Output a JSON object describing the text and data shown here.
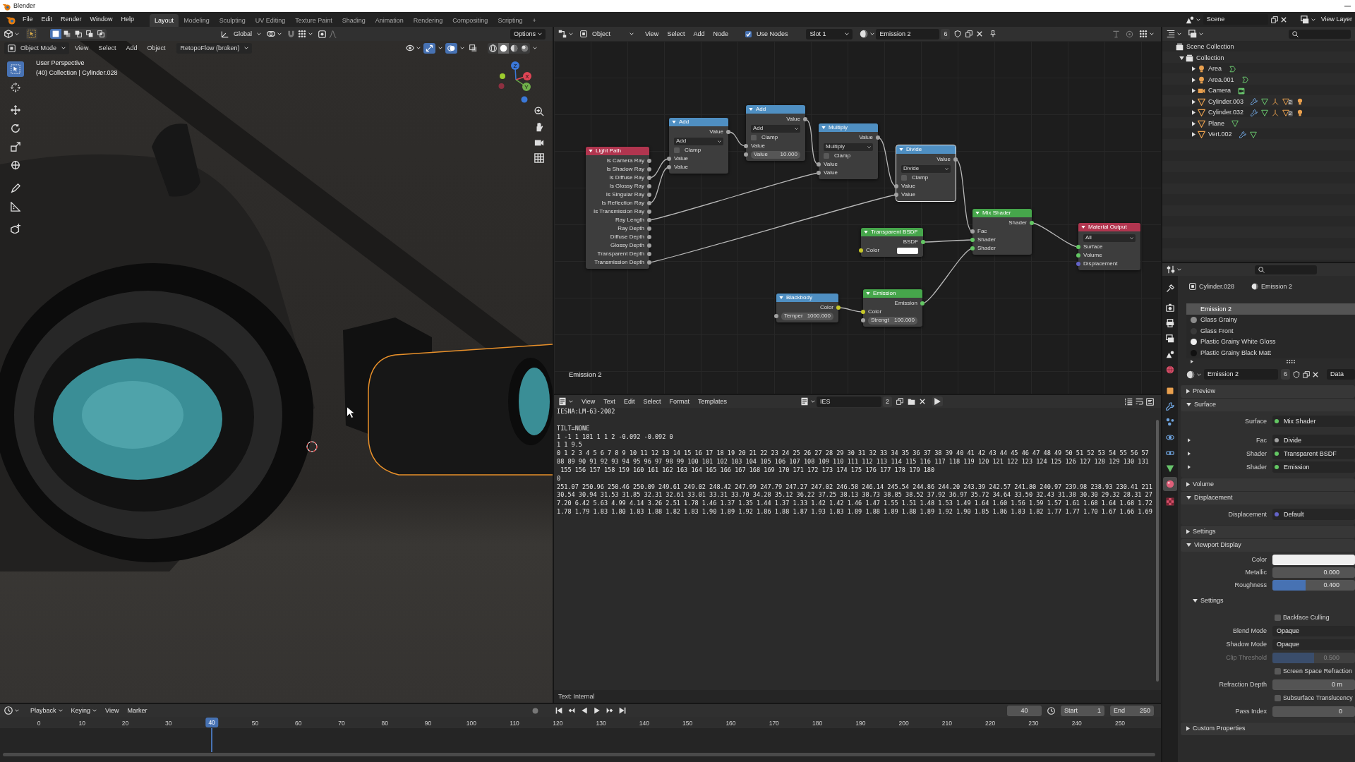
{
  "window": {
    "title": "Blender"
  },
  "top_bar": {
    "menus": [
      "File",
      "Edit",
      "Render",
      "Window",
      "Help"
    ],
    "workspaces": [
      {
        "label": "Layout",
        "selected": true
      },
      {
        "label": "Modeling",
        "selected": false
      },
      {
        "label": "Sculpting",
        "selected": false
      },
      {
        "label": "UV Editing",
        "selected": false
      },
      {
        "label": "Texture Paint",
        "selected": false
      },
      {
        "label": "Shading",
        "selected": false
      },
      {
        "label": "Animation",
        "selected": false
      },
      {
        "label": "Rendering",
        "selected": false
      },
      {
        "label": "Compositing",
        "selected": false
      },
      {
        "label": "Scripting",
        "selected": false
      }
    ],
    "add_tab": "+",
    "scene": "Scene",
    "view_layer": "View Layer"
  },
  "viewport": {
    "select_modes": [
      {
        "kind": "set",
        "selected": true
      },
      {
        "kind": "extend",
        "selected": false
      },
      {
        "kind": "subtract",
        "selected": false
      },
      {
        "kind": "invert",
        "selected": false
      },
      {
        "kind": "intersect",
        "selected": false
      }
    ],
    "orientation": "Global",
    "options": "Options",
    "mode": "Object Mode",
    "menus": [
      "View",
      "Select",
      "Add",
      "Object"
    ],
    "addon_menu": "RetopoFlow (broken)",
    "show_gizmos": true,
    "show_overlays": true,
    "xray": false,
    "shading": [
      {
        "kind": "wireframe",
        "selected": false
      },
      {
        "kind": "solid",
        "selected": true
      },
      {
        "kind": "material",
        "selected": false
      },
      {
        "kind": "rendered",
        "selected": false
      }
    ],
    "tools": [
      {
        "kind": "select_box",
        "selected": true
      },
      {
        "kind": "cursor",
        "selected": false
      },
      {
        "kind": "move",
        "selected": false
      },
      {
        "kind": "rotate",
        "selected": false
      },
      {
        "kind": "scale",
        "selected": false
      },
      {
        "kind": "transform",
        "selected": false
      },
      {
        "kind": "annotate",
        "selected": false
      },
      {
        "kind": "measure",
        "selected": false
      },
      {
        "kind": "add_cube",
        "selected": false
      }
    ],
    "view_name": "User Perspective",
    "object_info": "(40) Collection | Cylinder.028",
    "axes": [
      "X",
      "Y",
      "Z"
    ]
  },
  "node_editor": {
    "object_type": "Object",
    "menus": [
      "View",
      "Select",
      "Add",
      "Node"
    ],
    "use_nodes": {
      "label": "Use Nodes",
      "checked": true
    },
    "slot": "Slot 1",
    "material": "Emission 2",
    "users": "6",
    "frame_label": "Emission 2",
    "nodes": [
      {
        "title": "Light Path",
        "kind": "input",
        "selected": false,
        "outputs": [
          {
            "label": "Is Camera Ray",
            "kind": "value"
          },
          {
            "label": "Is Shadow Ray",
            "kind": "value"
          },
          {
            "label": "Is Diffuse Ray",
            "kind": "value"
          },
          {
            "label": "Is Glossy Ray",
            "kind": "value"
          },
          {
            "label": "Is Singular Ray",
            "kind": "value"
          },
          {
            "label": "Is Reflection Ray",
            "kind": "value"
          },
          {
            "label": "Is Transmission Ray",
            "kind": "value"
          },
          {
            "label": "Ray Length",
            "kind": "value"
          },
          {
            "label": "Ray Depth",
            "kind": "value"
          },
          {
            "label": "Diffuse Depth",
            "kind": "value"
          },
          {
            "label": "Glossy Depth",
            "kind": "value"
          },
          {
            "label": "Transparent Depth",
            "kind": "value"
          },
          {
            "label": "Transmission Depth",
            "kind": "value"
          }
        ]
      },
      {
        "title": "Add",
        "kind": "converter",
        "selected": false,
        "outputs": [
          {
            "label": "Value",
            "kind": "value"
          }
        ],
        "controls": [
          {
            "kind": "dropdown",
            "value": "Add"
          },
          {
            "kind": "checkbox",
            "label": "Clamp",
            "checked": false
          }
        ],
        "inputs": [
          {
            "label": "Value",
            "kind": "value"
          },
          {
            "label": "Value",
            "kind": "value"
          }
        ]
      },
      {
        "title": "Add",
        "kind": "converter",
        "selected": false,
        "outputs": [
          {
            "label": "Value",
            "kind": "value"
          }
        ],
        "controls": [
          {
            "kind": "dropdown",
            "value": "Add"
          },
          {
            "kind": "checkbox",
            "label": "Clamp",
            "checked": false
          }
        ],
        "inputs": [
          {
            "label": "Value",
            "kind": "value"
          },
          {
            "label": "Value",
            "value": "10.000",
            "kind": "value"
          }
        ]
      },
      {
        "title": "Multiply",
        "kind": "converter",
        "selected": false,
        "outputs": [
          {
            "label": "Value",
            "kind": "value"
          }
        ],
        "controls": [
          {
            "kind": "dropdown",
            "value": "Multiply"
          },
          {
            "kind": "checkbox",
            "label": "Clamp",
            "checked": false
          }
        ],
        "inputs": [
          {
            "label": "Value",
            "kind": "value"
          },
          {
            "label": "Value",
            "kind": "value"
          }
        ]
      },
      {
        "title": "Divide",
        "kind": "converter",
        "selected": true,
        "outputs": [
          {
            "label": "Value",
            "kind": "value"
          }
        ],
        "controls": [
          {
            "kind": "dropdown",
            "value": "Divide"
          },
          {
            "kind": "checkbox",
            "label": "Clamp",
            "checked": false
          }
        ],
        "inputs": [
          {
            "label": "Value",
            "kind": "value"
          },
          {
            "label": "Value",
            "kind": "value"
          }
        ]
      },
      {
        "title": "Transparent BSDF",
        "kind": "shader",
        "selected": false,
        "outputs": [
          {
            "label": "BSDF",
            "kind": "shader"
          }
        ],
        "inputs": [
          {
            "label": "Color",
            "kind": "color",
            "color": "#ffffff"
          }
        ]
      },
      {
        "title": "Mix Shader",
        "kind": "shader",
        "selected": false,
        "outputs": [
          {
            "label": "Shader",
            "kind": "shader"
          }
        ],
        "inputs": [
          {
            "label": "Fac",
            "kind": "value"
          },
          {
            "label": "Shader",
            "kind": "shader"
          },
          {
            "label": "Shader",
            "kind": "shader"
          }
        ]
      },
      {
        "title": "Material Output",
        "kind": "output",
        "selected": false,
        "controls": [
          {
            "kind": "dropdown",
            "value": "All"
          }
        ],
        "inputs": [
          {
            "label": "Surface",
            "kind": "shader"
          },
          {
            "label": "Volume",
            "kind": "shader"
          },
          {
            "label": "Displacement",
            "kind": "vector"
          }
        ]
      },
      {
        "title": "Blackbody",
        "kind": "converter",
        "selected": false,
        "outputs": [
          {
            "label": "Color",
            "kind": "color"
          }
        ],
        "inputs": [
          {
            "label": "Temper",
            "value": "1000.000",
            "kind": "value"
          }
        ]
      },
      {
        "title": "Emission",
        "kind": "shader",
        "selected": false,
        "outputs": [
          {
            "label": "Emission",
            "kind": "shader"
          }
        ],
        "inputs": [
          {
            "label": "Color",
            "kind": "color"
          },
          {
            "label": "Strengt",
            "value": "100.000",
            "kind": "value"
          }
        ]
      }
    ]
  },
  "text_editor": {
    "menus": [
      "View",
      "Text",
      "Edit",
      "Select",
      "Format",
      "Templates"
    ],
    "text_name": "IES",
    "users": "2",
    "paragraphs": [
      [
        "IESNA:LM-63-2002"
      ],
      [
        "TILT=NONE",
        "1 -1 1 181 1 1 2 -0.092 -0.092 0",
        "1 1 9.5",
        "0 1 2 3 4 5 6 7 8 9 10 11 12 13 14 15 16 17 18 19 20 21 22 23 24 25 26 27 28 29 30 31 32 33 34 35 36 37 38 39 40 41 42 43 44 45 46 47 48 49 50 51 52 53 54 55 56 57",
        "88 89 90 91 92 93 94 95 96 97 98 99 100 101 102 103 104 105 106 107 108 109 110 111 112 113 114 115 116 117 118 119 120 121 122 123 124 125 126 127 128 129 130 131",
        " 155 156 157 158 159 160 161 162 163 164 165 166 167 168 169 170 171 172 173 174 175 176 177 178 179 180",
        "0",
        "251.07 250.96 250.46 250.09 249.61 249.02 248.42 247.99 247.79 247.27 247.02 246.58 246.14 245.54 244.86 244.20 243.39 242.57 241.80 240.97 239.98 238.93 230.41 211",
        "30.54 30.94 31.53 31.85 32.31 32.61 33.01 33.31 33.70 34.28 35.12 36.22 37.25 38.13 38.73 38.85 38.52 37.92 36.97 35.72 34.64 33.50 32.43 31.38 30.30 29.32 28.31 27",
        "7.20 6.42 5.63 4.99 4.14 3.26 2.51 1.78 1.46 1.37 1.35 1.44 1.37 1.33 1.42 1.42 1.46 1.47 1.55 1.51 1.48 1.53 1.49 1.64 1.60 1.56 1.59 1.57 1.61 1.68 1.64 1.68 1.72",
        "1.78 1.79 1.83 1.80 1.83 1.88 1.82 1.83 1.90 1.89 1.92 1.86 1.88 1.87 1.93 1.83 1.89 1.88 1.89 1.88 1.89 1.92 1.90 1.85 1.86 1.83 1.82 1.77 1.77 1.70 1.67 1.66 1.69"
      ]
    ],
    "status": "Text: Internal"
  },
  "outliner": {
    "root": "Scene Collection",
    "items": [
      {
        "name": "Collection",
        "kind": "collection",
        "expanded": true,
        "children": [
          {
            "name": "Area",
            "kind": "light",
            "expanded": false,
            "extras": [
              {
                "kind": "light_data"
              }
            ]
          },
          {
            "name": "Area.001",
            "kind": "light",
            "expanded": false,
            "extras": [
              {
                "kind": "light_data"
              }
            ]
          },
          {
            "name": "Camera",
            "kind": "camera",
            "expanded": false,
            "extras": [
              {
                "kind": "camera_data"
              }
            ]
          },
          {
            "name": "Cylinder.003",
            "kind": "mesh",
            "expanded": false,
            "extras": [
              {
                "kind": "modifier"
              },
              {
                "kind": "mesh_data"
              },
              {
                "kind": "armature"
              },
              {
                "kind": "child_mesh",
                "count": "2"
              },
              {
                "kind": "child_light"
              }
            ]
          },
          {
            "name": "Cylinder.032",
            "kind": "mesh",
            "expanded": false,
            "extras": [
              {
                "kind": "modifier"
              },
              {
                "kind": "mesh_data"
              },
              {
                "kind": "armature"
              },
              {
                "kind": "child_mesh",
                "count": "2"
              },
              {
                "kind": "child_light"
              }
            ]
          },
          {
            "name": "Plane",
            "kind": "mesh",
            "expanded": false,
            "extras": [
              {
                "kind": "mesh_data"
              }
            ]
          },
          {
            "name": "Vert.002",
            "kind": "mesh",
            "expanded": false,
            "extras": [
              {
                "kind": "modifier"
              },
              {
                "kind": "mesh_data"
              }
            ]
          }
        ]
      }
    ]
  },
  "properties": {
    "tabs": [
      {
        "kind": "tool",
        "selected": false
      },
      {
        "kind": "render",
        "selected": false
      },
      {
        "kind": "output",
        "selected": false
      },
      {
        "kind": "view_layer",
        "selected": false
      },
      {
        "kind": "scene",
        "selected": false
      },
      {
        "kind": "world",
        "selected": false
      },
      {
        "kind": "object",
        "selected": false
      },
      {
        "kind": "modifiers",
        "selected": false
      },
      {
        "kind": "particles",
        "selected": false
      },
      {
        "kind": "physics",
        "selected": false
      },
      {
        "kind": "constraints",
        "selected": false
      },
      {
        "kind": "data",
        "selected": false
      },
      {
        "kind": "material",
        "selected": true
      },
      {
        "kind": "texture",
        "selected": false
      }
    ],
    "object": "Cylinder.028",
    "material_path": "Emission 2",
    "slots": [
      {
        "name": "Emission 2",
        "selected": true
      },
      {
        "name": "Glass Grainy",
        "selected": false,
        "color": "#8c8c8c"
      },
      {
        "name": "Glass Front",
        "selected": false,
        "color": "#3a3a3a"
      },
      {
        "name": "Plastic Grainy White Gloss",
        "selected": false,
        "color": "#eeeeee"
      },
      {
        "name": "Plastic Grainy Black Matt",
        "selected": false,
        "color": "#111111"
      }
    ],
    "material": "Emission 2",
    "users": "6",
    "link": "Data",
    "panels": [
      {
        "title": "Preview",
        "expanded": false
      },
      {
        "title": "Surface",
        "expanded": true,
        "rows": [
          {
            "kind": "link",
            "label": "Surface",
            "value": "Mix Shader",
            "color": "#63c763"
          },
          {
            "kind": "link",
            "label": "Fac",
            "value": "Divide",
            "color": "#a1a1a1",
            "expanded": false
          },
          {
            "kind": "link",
            "label": "Shader",
            "value": "Transparent BSDF",
            "color": "#63c763",
            "expanded": false
          },
          {
            "kind": "link",
            "label": "Shader",
            "value": "Emission",
            "color": "#63c763",
            "expanded": false
          }
        ]
      },
      {
        "title": "Volume",
        "expanded": false
      },
      {
        "title": "Displacement",
        "expanded": true,
        "rows": [
          {
            "kind": "link",
            "label": "Displacement",
            "value": "Default",
            "color": "#6363c7"
          }
        ]
      },
      {
        "title": "Settings",
        "expanded": false
      },
      {
        "title": "Viewport Display",
        "expanded": true,
        "rows": [
          {
            "kind": "swatch",
            "label": "Color",
            "color": "#f0f0f0"
          },
          {
            "kind": "slider",
            "label": "Metallic",
            "value": "0.000",
            "level": 0
          },
          {
            "kind": "slider",
            "label": "Roughness",
            "value": "0.400",
            "level": 0.4
          },
          {
            "kind": "subpanel",
            "title": "Settings",
            "expanded": true,
            "rows": [
              {
                "kind": "checkbox",
                "label": "Backface Culling",
                "checked": false,
                "disabled": false
              },
              {
                "kind": "dropdown",
                "label": "Blend Mode",
                "value": "Opaque",
                "disabled": false
              },
              {
                "kind": "dropdown",
                "label": "Shadow Mode",
                "value": "Opaque",
                "disabled": false
              },
              {
                "kind": "slider",
                "label": "Clip Threshold",
                "value": "0.500",
                "level": 0.5,
                "disabled": true
              },
              {
                "kind": "checkbox",
                "label": "Screen Space Refraction",
                "checked": false,
                "disabled": false
              },
              {
                "kind": "number",
                "label": "Refraction Depth",
                "value": "0 m",
                "disabled": false
              },
              {
                "kind": "checkbox",
                "label": "Subsurface Translucency",
                "checked": false,
                "disabled": false
              },
              {
                "kind": "number",
                "label": "Pass Index",
                "value": "0",
                "disabled": false
              }
            ]
          }
        ]
      },
      {
        "title": "Custom Properties",
        "expanded": false
      }
    ]
  },
  "timeline": {
    "menus": [
      {
        "label": "Playback",
        "dropdown": true
      },
      {
        "label": "Keying",
        "dropdown": true
      },
      {
        "label": "View",
        "dropdown": false
      },
      {
        "label": "Marker",
        "dropdown": false
      }
    ],
    "current_frame": "40",
    "start_label": "Start",
    "start": "1",
    "end_label": "End",
    "end": "250",
    "ruler": [
      "0",
      "10",
      "20",
      "30",
      "50",
      "60",
      "70",
      "80",
      "90",
      "100",
      "110",
      "120",
      "130",
      "140",
      "150",
      "160",
      "170",
      "180",
      "190",
      "200",
      "210",
      "220",
      "230",
      "240",
      "250"
    ],
    "playhead": "40"
  }
}
